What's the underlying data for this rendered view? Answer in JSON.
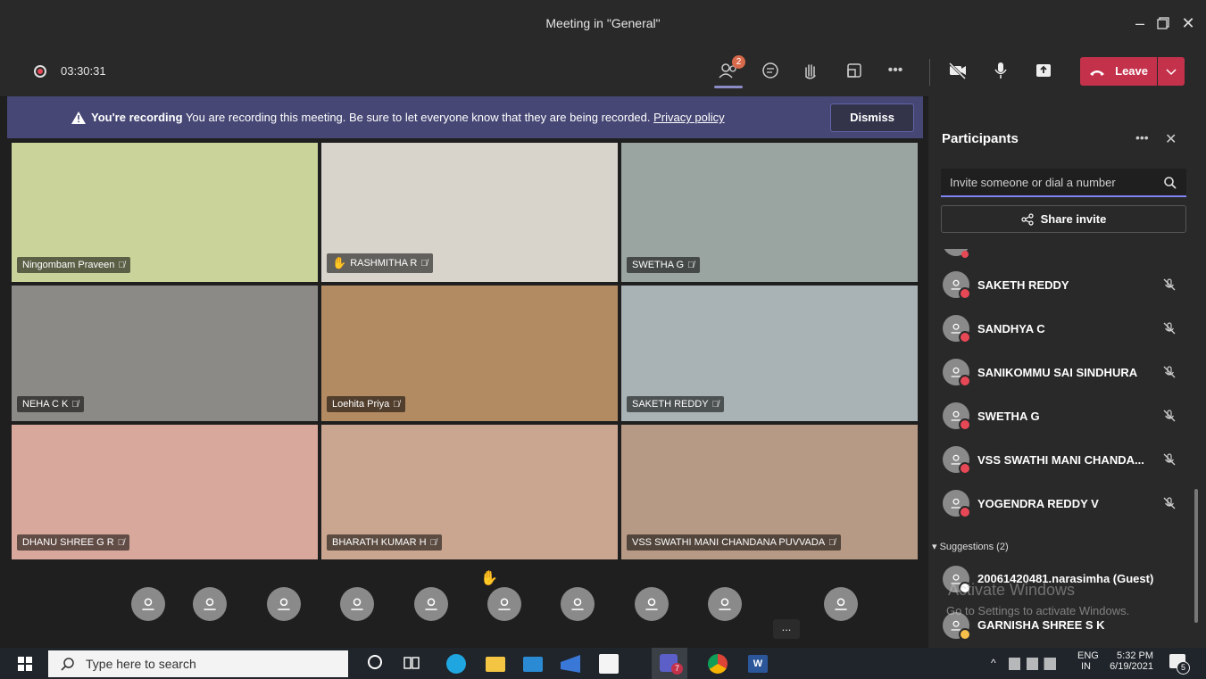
{
  "window": {
    "title": "Meeting in \"General\""
  },
  "meeting": {
    "timer": "03:30:31",
    "people_badge": "2",
    "leave_label": "Leave"
  },
  "banner": {
    "bold": "You're recording",
    "text": "You are recording this meeting. Be sure to let everyone know that they are being recorded.",
    "link": "Privacy policy",
    "dismiss": "Dismiss"
  },
  "tiles": [
    {
      "name": "Ningombam Praveen",
      "bg": "#c9d39a"
    },
    {
      "name": "RASHMITHA R",
      "bg": "#d8d4cc"
    },
    {
      "name": "SWETHA G",
      "bg": "#9aa5a2"
    },
    {
      "name": "NEHA C K",
      "bg": "#8c8a86"
    },
    {
      "name": "Loehita Priya",
      "bg": "#b38b62"
    },
    {
      "name": "SAKETH REDDY",
      "bg": "#a9b3b6"
    },
    {
      "name": "DHANU SHREE G R",
      "bg": "#d9a89c"
    },
    {
      "name": "BHARATH KUMAR H",
      "bg": "#caa690"
    },
    {
      "name": "VSS SWATHI MANI CHANDANA PUVVADA",
      "bg": "#b79a86"
    }
  ],
  "panel": {
    "title": "Participants",
    "invite_placeholder": "Invite someone or dial a number",
    "share_invite": "Share invite",
    "participants": [
      "SAKETH REDDY",
      "SANDHYA C",
      "SANIKOMMU SAI SINDHURA",
      "SWETHA G",
      "VSS SWATHI MANI CHANDA...",
      "YOGENDRA REDDY V"
    ],
    "suggestions_label": "Suggestions (2)",
    "suggestions": [
      "20061420481.narasimha (Guest)",
      "GARNISHA SHREE S K"
    ],
    "watermark_title": "Activate Windows",
    "watermark_sub": "Go to Settings to activate Windows."
  },
  "taskbar": {
    "search_placeholder": "Type here to search",
    "lang": "ENG",
    "region": "IN",
    "time": "5:32 PM",
    "date": "6/19/2021",
    "teams_badge": "7",
    "notif_count": "5"
  },
  "colors": {
    "accent": "#6264a7",
    "leave": "#c4314b",
    "banner": "#464775",
    "recording": "#e74856"
  }
}
